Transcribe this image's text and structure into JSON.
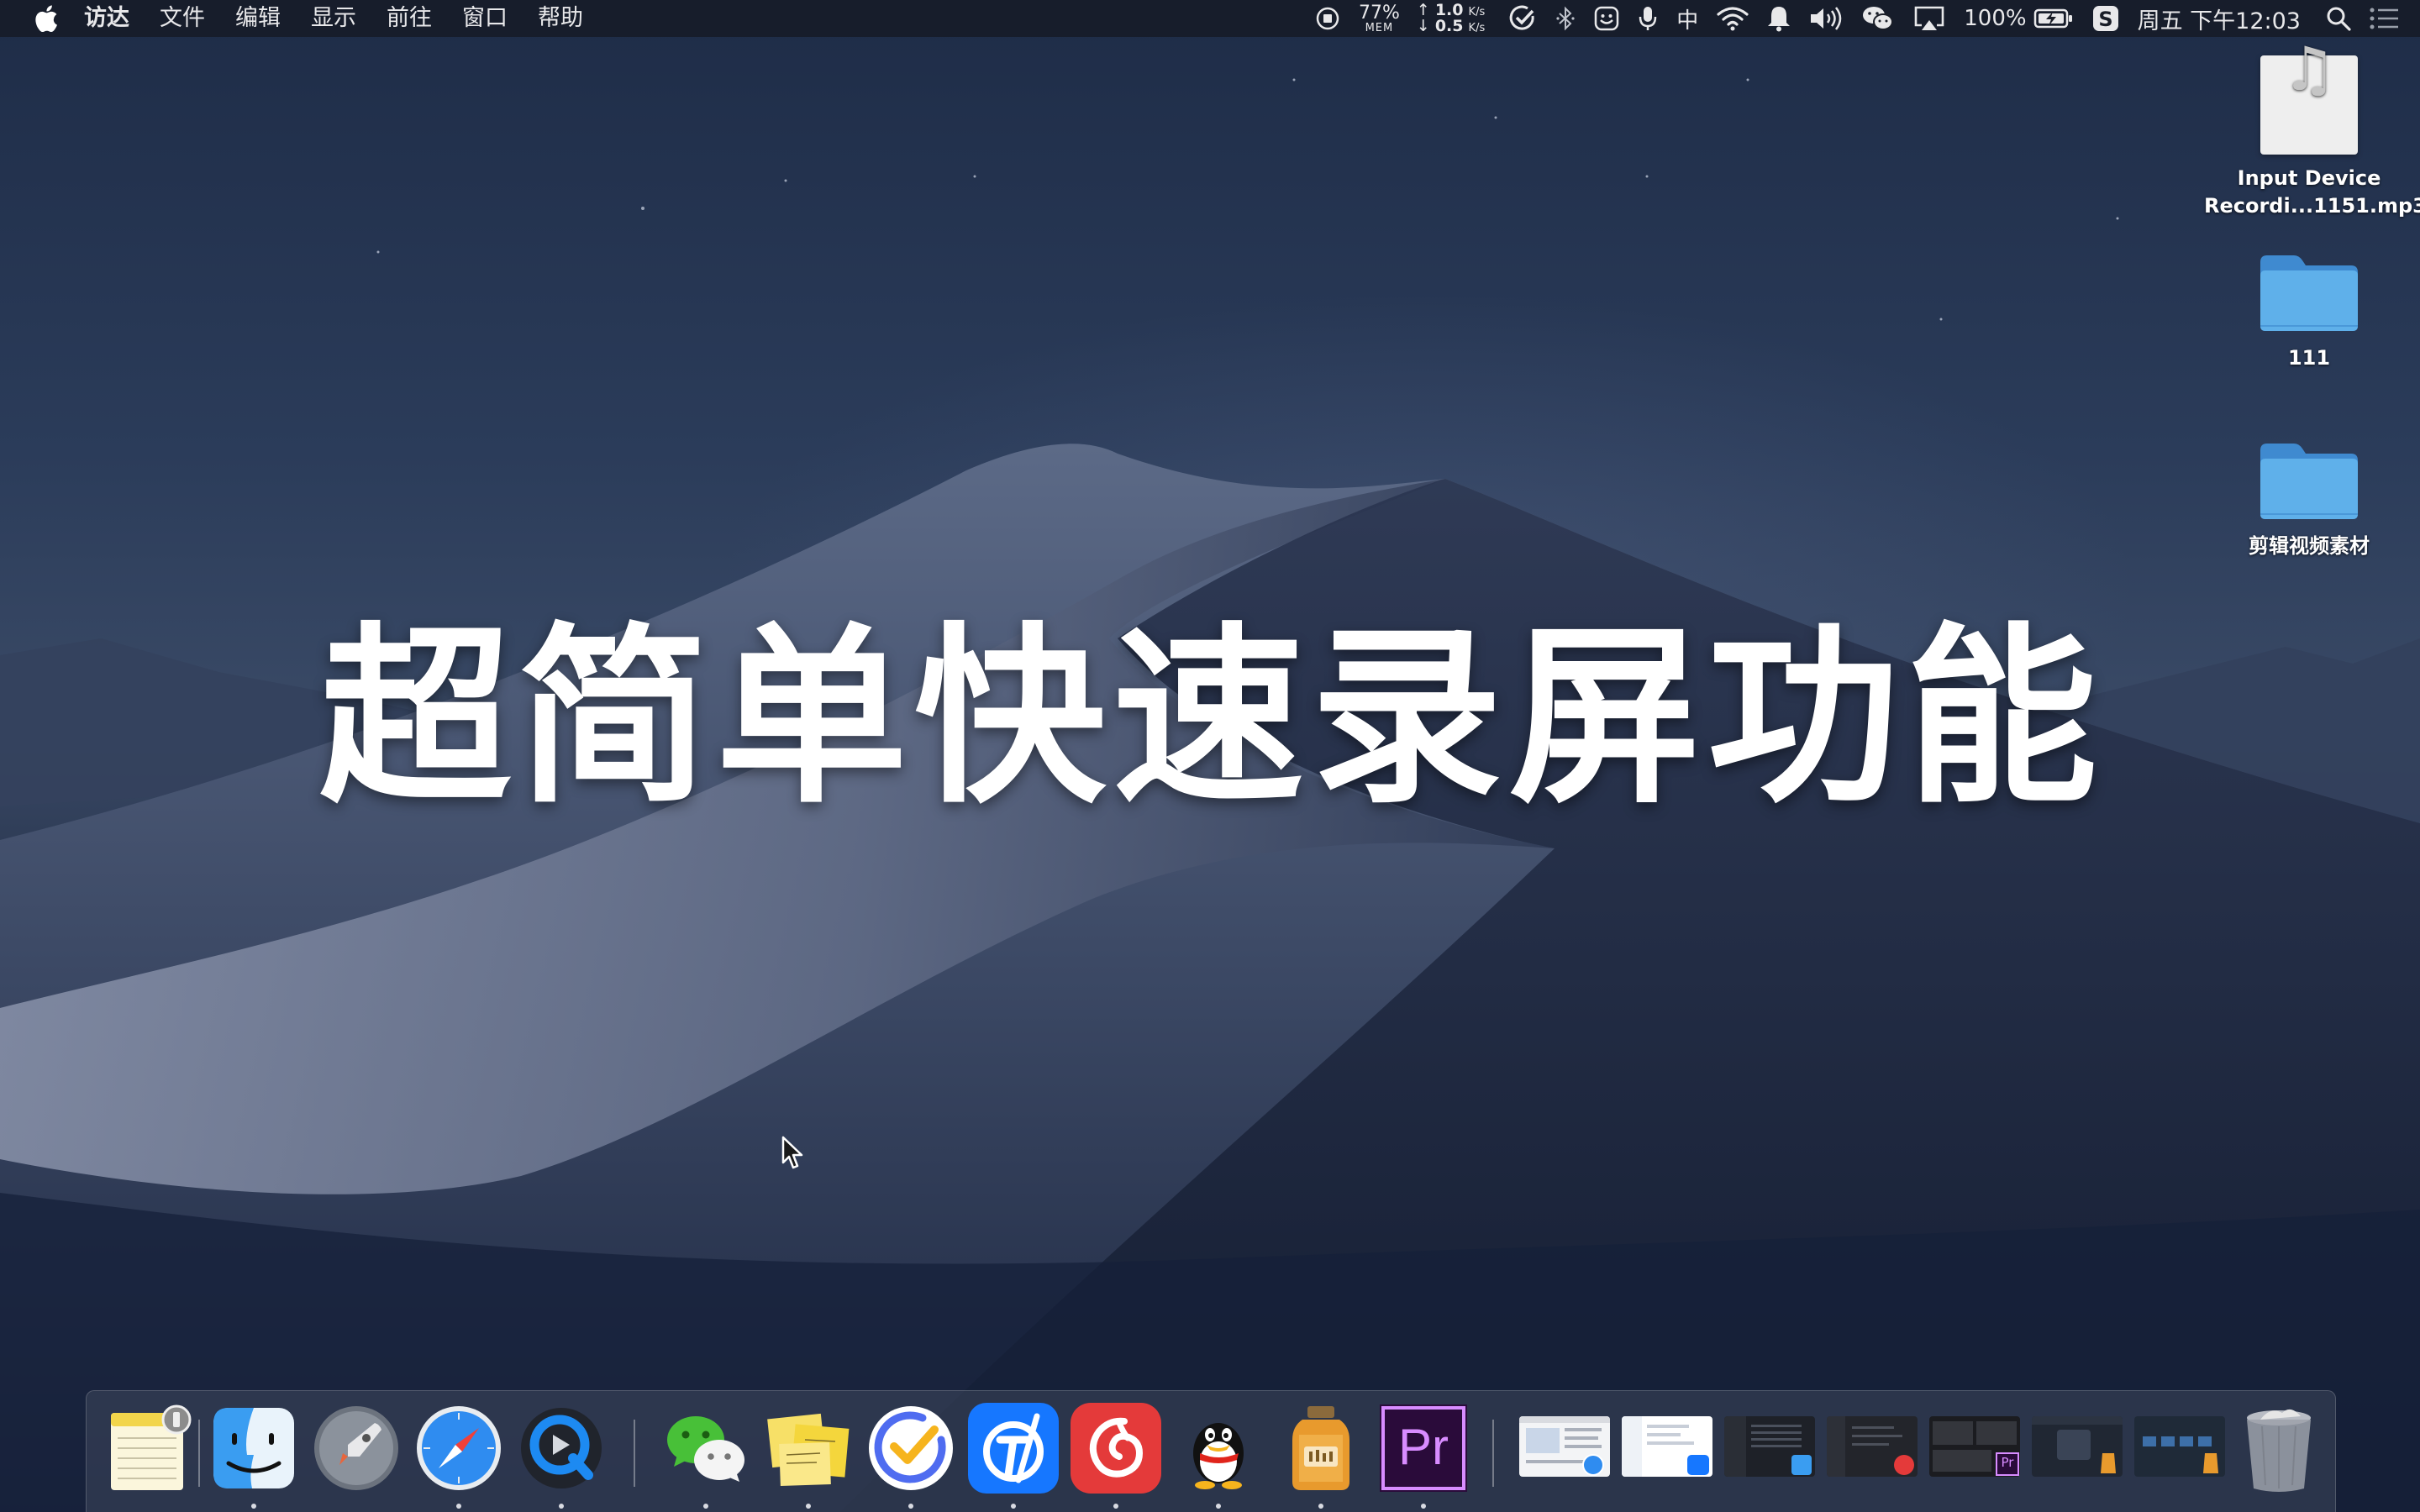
{
  "menubar": {
    "app_menu": "访达",
    "menus": [
      "文件",
      "编辑",
      "显示",
      "前往",
      "窗口",
      "帮助"
    ],
    "memory": {
      "percent": "77%",
      "label": "MEM"
    },
    "network": {
      "up": "1.0",
      "up_unit": "K/s",
      "down": "0.5",
      "down_unit": "K/s"
    },
    "input_method": "中",
    "battery": "100%",
    "clock": "周五 下午12:03"
  },
  "desktop": {
    "items": [
      {
        "label": "Input Device Recordi...1151.mp3",
        "icon": "music-file-icon"
      },
      {
        "label": "111",
        "icon": "folder-icon"
      },
      {
        "label": "剪辑视频素材",
        "icon": "folder-icon"
      }
    ]
  },
  "overlay": {
    "headline": "超简单快速录屏功能"
  },
  "dock": {
    "apps": [
      {
        "icon": "notes-icon"
      },
      {
        "icon": "finder-icon"
      },
      {
        "icon": "launchpad-icon"
      },
      {
        "icon": "safari-icon"
      },
      {
        "icon": "quicktime-icon"
      },
      {
        "icon": "wechat-icon"
      },
      {
        "icon": "stickies-icon"
      },
      {
        "icon": "ticktick-icon"
      },
      {
        "icon": "dingtalk-icon"
      },
      {
        "icon": "netease-music-icon"
      },
      {
        "icon": "qq-icon"
      },
      {
        "icon": "jar-app-icon"
      },
      {
        "icon": "premiere-icon",
        "label": "Pr"
      }
    ],
    "minimized_windows": [
      {
        "icon": "safari-window-thumbnail"
      },
      {
        "icon": "dingtalk-window-thumbnail"
      },
      {
        "icon": "finder-window-thumbnail"
      },
      {
        "icon": "netease-window-thumbnail"
      },
      {
        "icon": "premiere-window-thumbnail",
        "label": "Pr"
      },
      {
        "icon": "jar-window-thumbnail"
      },
      {
        "icon": "jar-window-thumbnail-2"
      }
    ],
    "trash": {
      "icon": "trash-icon"
    }
  }
}
